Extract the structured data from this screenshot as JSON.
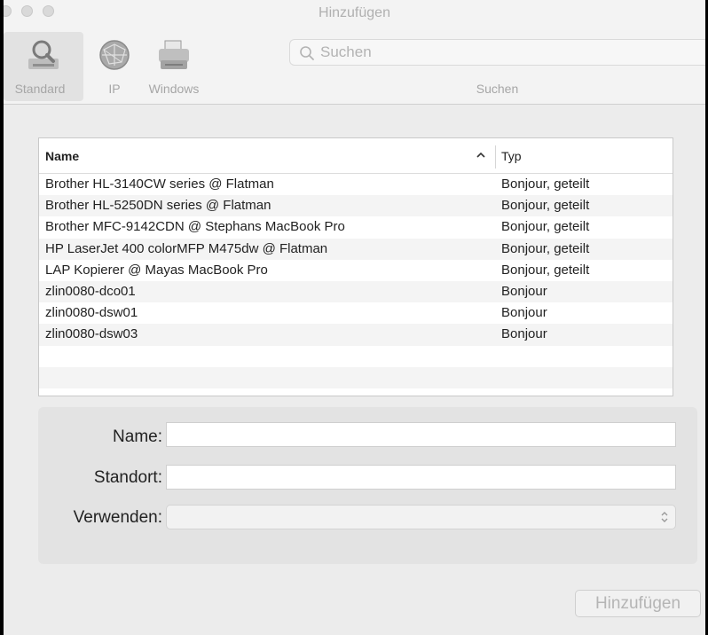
{
  "window": {
    "title": "Hinzufügen"
  },
  "toolbar": {
    "tabs": [
      {
        "label": "Standard",
        "icon": "printer-magnifier-icon",
        "selected": true
      },
      {
        "label": "IP",
        "icon": "globe-network-icon",
        "selected": false
      },
      {
        "label": "Windows",
        "icon": "windows-printer-icon",
        "selected": false
      }
    ],
    "search": {
      "placeholder": "Suchen",
      "caption": "Suchen"
    }
  },
  "printer_table": {
    "columns": [
      {
        "label": "Name",
        "sort": "ascending"
      },
      {
        "label": "Typ"
      }
    ],
    "rows": [
      {
        "name": "Brother HL-3140CW series @ Flatman",
        "type": "Bonjour, geteilt"
      },
      {
        "name": "Brother HL-5250DN series @ Flatman",
        "type": "Bonjour, geteilt"
      },
      {
        "name": "Brother MFC-9142CDN @ Stephans MacBook Pro",
        "type": "Bonjour, geteilt"
      },
      {
        "name": "HP LaserJet 400 colorMFP M475dw @ Flatman",
        "type": "Bonjour, geteilt"
      },
      {
        "name": "LAP Kopierer @ Mayas MacBook Pro",
        "type": "Bonjour, geteilt"
      },
      {
        "name": "zlin0080-dco01",
        "type": "Bonjour"
      },
      {
        "name": "zlin0080-dsw01",
        "type": "Bonjour"
      },
      {
        "name": "zlin0080-dsw03",
        "type": "Bonjour"
      }
    ]
  },
  "form": {
    "name_label": "Name:",
    "name_value": "",
    "location_label": "Standort:",
    "location_value": "",
    "use_label": "Verwenden:",
    "use_value": ""
  },
  "footer": {
    "add_button_label": "Hinzufügen"
  },
  "colors": {
    "window_bg": "#ececec",
    "toolbar_bg": "#f3f3f3",
    "disabled_text": "#b0b0b0"
  }
}
